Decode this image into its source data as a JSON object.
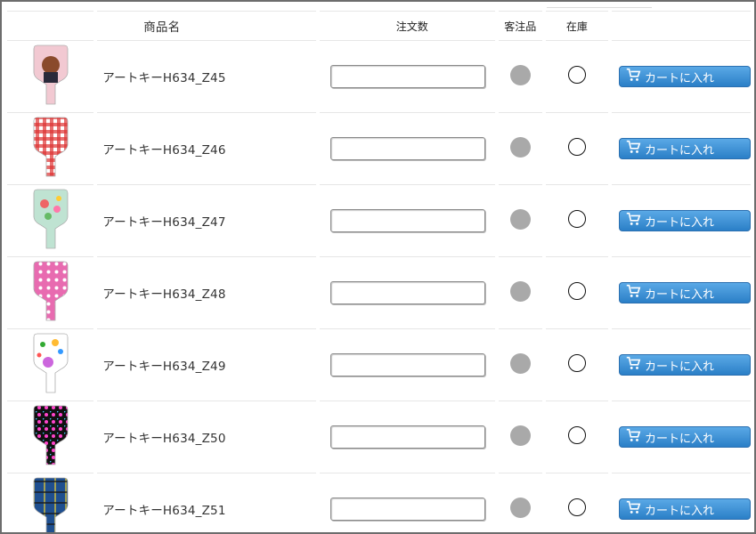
{
  "table": {
    "headers": {
      "image": "",
      "name": "商品名",
      "quantity": "注文数",
      "custom_order": "客注品",
      "stock": "在庫",
      "cart": ""
    },
    "cart_label": "カートに入れ",
    "rows": [
      {
        "name": "アートキーH634_Z45",
        "pattern": "poodle",
        "quantity": ""
      },
      {
        "name": "アートキーH634_Z46",
        "pattern": "gingham",
        "quantity": ""
      },
      {
        "name": "アートキーH634_Z47",
        "pattern": "floral",
        "quantity": ""
      },
      {
        "name": "アートキーH634_Z48",
        "pattern": "pink-polka",
        "quantity": ""
      },
      {
        "name": "アートキーH634_Z49",
        "pattern": "color-dots",
        "quantity": ""
      },
      {
        "name": "アートキーH634_Z50",
        "pattern": "black-dots",
        "quantity": ""
      },
      {
        "name": "アートキーH634_Z51",
        "pattern": "blue-plaid",
        "quantity": ""
      }
    ]
  },
  "colors": {
    "cart_button": "#3a8fd6",
    "custom_order_dot": "#a9a9a9",
    "stock_ring": "#111111"
  }
}
